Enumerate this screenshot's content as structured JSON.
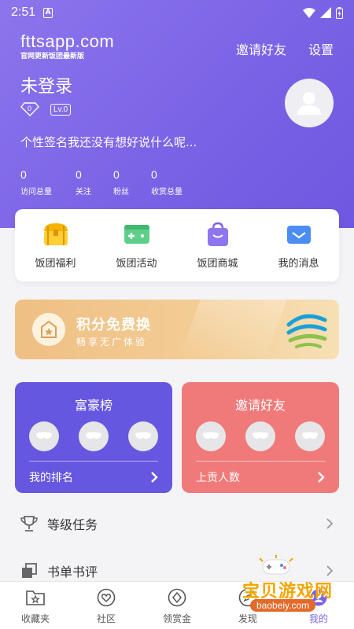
{
  "status_bar": {
    "time": "2:51",
    "notification_badge": "A"
  },
  "header": {
    "app_name": "fttsapp.com",
    "app_tagline": "官网更新饭团最新版",
    "invite_label": "邀请好友",
    "settings_label": "设置"
  },
  "profile": {
    "username": "未登录",
    "diamond_count": "0",
    "level": "Lv.0",
    "signature": "个性签名我还没有想好说什么呢..."
  },
  "stats": [
    {
      "value": "0",
      "label": "访问总量"
    },
    {
      "value": "0",
      "label": "关注"
    },
    {
      "value": "0",
      "label": "粉丝"
    },
    {
      "value": "0",
      "label": "收赏总量"
    }
  ],
  "quick_actions": [
    {
      "label": "饭团福利",
      "icon": "treasure-chest-icon"
    },
    {
      "label": "饭团活动",
      "icon": "gamepad-icon"
    },
    {
      "label": "饭团商城",
      "icon": "shopping-bag-icon"
    },
    {
      "label": "我的消息",
      "icon": "envelope-icon"
    }
  ],
  "banner": {
    "title": "积分免费换",
    "subtitle": "畅享无广体验"
  },
  "cards": {
    "rich_list": {
      "title": "富豪榜",
      "footer": "我的排名"
    },
    "invite": {
      "title": "邀请好友",
      "footer": "上贡人数"
    }
  },
  "menu": [
    {
      "label": "等级任务",
      "icon": "trophy-icon"
    },
    {
      "label": "书单书评",
      "icon": "booklist-icon"
    }
  ],
  "tabs": [
    {
      "label": "收藏夹",
      "icon": "folder-star-icon"
    },
    {
      "label": "社区",
      "icon": "heart-chat-icon"
    },
    {
      "label": "领赏金",
      "icon": "diamond-icon"
    },
    {
      "label": "发现",
      "icon": "compass-icon"
    },
    {
      "label": "我的",
      "icon": "person-icon"
    }
  ],
  "watermark": {
    "title": "宝贝游戏网",
    "url": "baobeiy.com"
  },
  "colors": {
    "primary": "#7b63e6",
    "rich_card": "#6557df",
    "invite_card": "#f07a7a",
    "banner": "#f3cc94"
  }
}
